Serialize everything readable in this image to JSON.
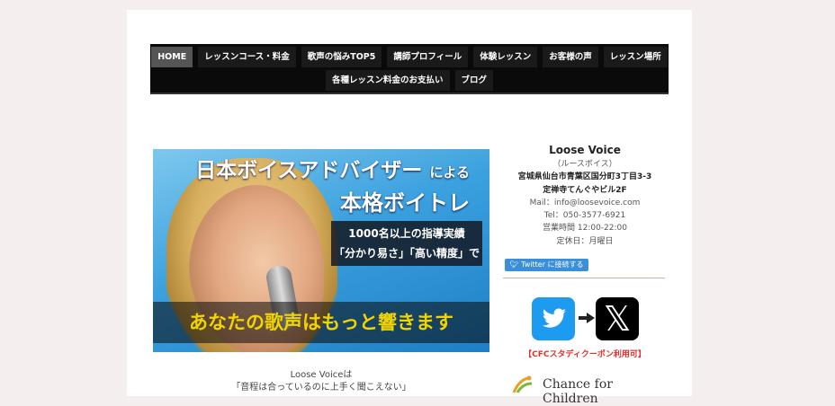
{
  "nav": {
    "row1": [
      "HOME",
      "レッスンコース・料金",
      "歌声の悩みTOP5",
      "講師プロフィール",
      "体験レッスン",
      "お客様の声",
      "レッスン場所"
    ],
    "row2": [
      "各種レッスン料金のお支払い",
      "ブログ"
    ],
    "active": "HOME"
  },
  "hero": {
    "line1": "日本ボイスアドバイザー",
    "line1_small": "による",
    "line2": "本格ボイトレ",
    "box_line1": "1000名以上の指導実績",
    "box_line2": "「分かり易さ」「高い精度」で",
    "band": "あなたの歌声はもっと響きます"
  },
  "intro": {
    "line1": "Loose Voiceは",
    "line2": "「音程は合っているのに上手く聞こえない」"
  },
  "sidebar": {
    "name": "Loose Voice",
    "reading": "（ルースボイス）",
    "address1": "宮城県仙台市青葉区国分町3丁目3-3",
    "address2": "定禅寺てんぐやビル2F",
    "mail": "Mail：info@loosevoice.com",
    "tel": "Tel：050-3577-6921",
    "hours": "営業時間 12:00-22:00",
    "holiday": "定休日：月曜日",
    "twitter_button": "Twitter に接続する",
    "coupon": "【CFCスタディクーポン利用可】",
    "cfc_text": "Chance for Children"
  },
  "colors": {
    "nav_bg": "#0a0a0a",
    "twitter_blue": "#1d9bf0",
    "hero_yellow": "#f2d400",
    "coupon_red": "#e03030"
  }
}
